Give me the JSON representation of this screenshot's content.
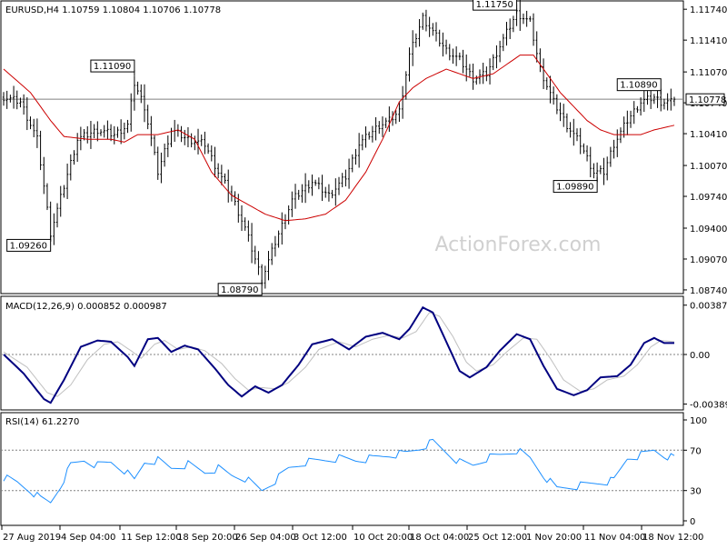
{
  "chart_data": [
    {
      "type": "candlestick",
      "symbol": "EURUSD",
      "timeframe": "H4",
      "header": "EURUSD,H4  1.10759 1.10804 1.10706 1.10778",
      "ohlc": {
        "open": 1.10759,
        "high": 1.10804,
        "low": 1.10706,
        "close": 1.10778
      },
      "y_ticks": [
        "1.11740",
        "1.11410",
        "1.11070",
        "1.10740",
        "1.10410",
        "1.10070",
        "1.09740",
        "1.09400",
        "1.09070",
        "1.08740"
      ],
      "ylim": [
        1.0872,
        1.118
      ],
      "last_price": "1.10778",
      "watermark": "ActionForex.com",
      "x_labels": [
        "27 Aug 2019",
        "4 Sep 04:00",
        "11 Sep 12:00",
        "18 Sep 20:00",
        "26 Sep 04:00",
        "3 Oct 12:00",
        "10 Oct 20:00",
        "18 Oct 04:00",
        "25 Oct 12:00",
        "1 Nov 20:00",
        "11 Nov 04:00",
        "18 Nov 12:00"
      ],
      "annotations": [
        {
          "text": "1.09260",
          "bar": 14
        },
        {
          "text": "1.11090",
          "bar": 39
        },
        {
          "text": "1.08790",
          "bar": 77
        },
        {
          "text": "1.11750",
          "bar": 153
        },
        {
          "text": "1.09890",
          "bar": 177
        },
        {
          "text": "1.10890",
          "bar": 196
        }
      ],
      "close_path": [
        [
          0,
          1.108
        ],
        [
          5,
          1.1075
        ],
        [
          10,
          1.1035
        ],
        [
          14,
          1.0935
        ],
        [
          18,
          1.0985
        ],
        [
          22,
          1.1035
        ],
        [
          28,
          1.1045
        ],
        [
          33,
          1.104
        ],
        [
          37,
          1.105
        ],
        [
          39,
          1.1095
        ],
        [
          42,
          1.107
        ],
        [
          46,
          1.1
        ],
        [
          50,
          1.1045
        ],
        [
          55,
          1.1035
        ],
        [
          60,
          1.103
        ],
        [
          64,
          1.1
        ],
        [
          68,
          1.0975
        ],
        [
          72,
          1.094
        ],
        [
          77,
          1.0885
        ],
        [
          81,
          1.0925
        ],
        [
          86,
          1.097
        ],
        [
          92,
          1.099
        ],
        [
          97,
          1.0975
        ],
        [
          102,
          1.0995
        ],
        [
          106,
          1.103
        ],
        [
          112,
          1.105
        ],
        [
          115,
          1.1055
        ],
        [
          118,
          1.1065
        ],
        [
          121,
          1.1125
        ],
        [
          125,
          1.1165
        ],
        [
          128,
          1.115
        ],
        [
          132,
          1.113
        ],
        [
          136,
          1.112
        ],
        [
          140,
          1.11
        ],
        [
          144,
          1.1105
        ],
        [
          148,
          1.1135
        ],
        [
          153,
          1.117
        ],
        [
          157,
          1.116
        ],
        [
          160,
          1.111
        ],
        [
          164,
          1.1075
        ],
        [
          168,
          1.105
        ],
        [
          172,
          1.103
        ],
        [
          176,
          1.1
        ],
        [
          179,
          1.1
        ],
        [
          182,
          1.103
        ],
        [
          186,
          1.1055
        ],
        [
          190,
          1.1075
        ],
        [
          194,
          1.108
        ],
        [
          196,
          1.1075
        ],
        [
          200,
          1.1075
        ]
      ],
      "ma_path": [
        [
          0,
          1.111
        ],
        [
          8,
          1.1085
        ],
        [
          14,
          1.1055
        ],
        [
          18,
          1.1038
        ],
        [
          25,
          1.1035
        ],
        [
          32,
          1.1035
        ],
        [
          36,
          1.1032
        ],
        [
          40,
          1.104
        ],
        [
          46,
          1.104
        ],
        [
          52,
          1.1045
        ],
        [
          57,
          1.1035
        ],
        [
          62,
          1.1
        ],
        [
          68,
          1.0975
        ],
        [
          73,
          1.0965
        ],
        [
          78,
          1.0955
        ],
        [
          84,
          1.0948
        ],
        [
          90,
          1.095
        ],
        [
          96,
          1.0955
        ],
        [
          102,
          1.097
        ],
        [
          108,
          1.1
        ],
        [
          113,
          1.1035
        ],
        [
          118,
          1.1075
        ],
        [
          122,
          1.109
        ],
        [
          126,
          1.11
        ],
        [
          132,
          1.111
        ],
        [
          136,
          1.1105
        ],
        [
          140,
          1.11
        ],
        [
          146,
          1.1105
        ],
        [
          150,
          1.1115
        ],
        [
          154,
          1.1125
        ],
        [
          158,
          1.1125
        ],
        [
          162,
          1.1105
        ],
        [
          166,
          1.1085
        ],
        [
          170,
          1.107
        ],
        [
          174,
          1.1055
        ],
        [
          178,
          1.1045
        ],
        [
          182,
          1.104
        ],
        [
          186,
          1.104
        ],
        [
          190,
          1.104
        ],
        [
          194,
          1.1045
        ],
        [
          200,
          1.105
        ]
      ],
      "range_pattern": [
        0.0011,
        0.0018,
        0.0007,
        0.0023,
        0.0013,
        0.0009,
        0.0016,
        0.0021,
        0.0008,
        0.0014,
        0.0026,
        0.0011,
        0.0017,
        0.0006,
        0.0012,
        0.0019
      ],
      "n_bars": 201,
      "colors": {
        "candle": "#000000",
        "ma": "#cc0000",
        "hline": "#808080"
      }
    },
    {
      "type": "line",
      "title": "MACD(12,26,9) 0.000852 0.000987",
      "y_ticks": [
        "0.003876",
        "0.00",
        "-0.003899"
      ],
      "ylim": [
        -0.004,
        0.004
      ],
      "macd_path": [
        [
          0,
          0.0
        ],
        [
          6,
          -0.0015
        ],
        [
          12,
          -0.0035
        ],
        [
          14,
          -0.0038
        ],
        [
          18,
          -0.002
        ],
        [
          23,
          0.0006
        ],
        [
          28,
          0.0011
        ],
        [
          32,
          0.001
        ],
        [
          37,
          -0.0002
        ],
        [
          39,
          -0.0009
        ],
        [
          43,
          0.0012
        ],
        [
          46,
          0.0013
        ],
        [
          50,
          0.0002
        ],
        [
          54,
          0.0007
        ],
        [
          58,
          0.0004
        ],
        [
          63,
          -0.0011
        ],
        [
          67,
          -0.0024
        ],
        [
          71,
          -0.0033
        ],
        [
          75,
          -0.0025
        ],
        [
          79,
          -0.003
        ],
        [
          83,
          -0.0024
        ],
        [
          88,
          -0.0008
        ],
        [
          92,
          0.0008
        ],
        [
          98,
          0.0012
        ],
        [
          103,
          0.0004
        ],
        [
          108,
          0.0014
        ],
        [
          113,
          0.0017
        ],
        [
          118,
          0.0012
        ],
        [
          121,
          0.002
        ],
        [
          125,
          0.0037
        ],
        [
          128,
          0.0033
        ],
        [
          132,
          0.001
        ],
        [
          136,
          -0.0013
        ],
        [
          139,
          -0.0018
        ],
        [
          144,
          -0.001
        ],
        [
          148,
          0.0003
        ],
        [
          153,
          0.0016
        ],
        [
          157,
          0.0012
        ],
        [
          161,
          -0.0009
        ],
        [
          165,
          -0.0027
        ],
        [
          170,
          -0.0032
        ],
        [
          174,
          -0.0028
        ],
        [
          178,
          -0.0018
        ],
        [
          183,
          -0.0017
        ],
        [
          187,
          -0.0008
        ],
        [
          191,
          0.0009
        ],
        [
          194,
          0.0013
        ],
        [
          197,
          0.0009
        ],
        [
          200,
          0.0009
        ]
      ],
      "signal_path": [
        [
          0,
          0.0002
        ],
        [
          7,
          -0.001
        ],
        [
          13,
          -0.003
        ],
        [
          16,
          -0.0033
        ],
        [
          20,
          -0.0024
        ],
        [
          25,
          -0.0004
        ],
        [
          30,
          0.0008
        ],
        [
          34,
          0.001
        ],
        [
          38,
          0.0003
        ],
        [
          41,
          -0.0003
        ],
        [
          45,
          0.0008
        ],
        [
          48,
          0.0011
        ],
        [
          52,
          0.0004
        ],
        [
          56,
          0.0006
        ],
        [
          60,
          0.0003
        ],
        [
          65,
          -0.0007
        ],
        [
          69,
          -0.0019
        ],
        [
          73,
          -0.0028
        ],
        [
          77,
          -0.0026
        ],
        [
          81,
          -0.0027
        ],
        [
          85,
          -0.0022
        ],
        [
          90,
          -0.001
        ],
        [
          94,
          0.0004
        ],
        [
          100,
          0.001
        ],
        [
          105,
          0.0006
        ],
        [
          110,
          0.0012
        ],
        [
          115,
          0.0015
        ],
        [
          119,
          0.0013
        ],
        [
          123,
          0.0018
        ],
        [
          127,
          0.0033
        ],
        [
          130,
          0.003
        ],
        [
          134,
          0.0014
        ],
        [
          138,
          -0.0006
        ],
        [
          141,
          -0.0013
        ],
        [
          146,
          -0.0008
        ],
        [
          150,
          0.0002
        ],
        [
          155,
          0.0013
        ],
        [
          159,
          0.0012
        ],
        [
          163,
          -0.0003
        ],
        [
          167,
          -0.002
        ],
        [
          172,
          -0.0029
        ],
        [
          176,
          -0.0027
        ],
        [
          180,
          -0.002
        ],
        [
          185,
          -0.0017
        ],
        [
          189,
          -0.0008
        ],
        [
          193,
          0.0006
        ],
        [
          196,
          0.0011
        ],
        [
          200,
          0.001
        ]
      ],
      "colors": {
        "macd": "#000080",
        "signal": "#c0c0c0"
      }
    },
    {
      "type": "line",
      "title": "RSI(14) 61.2270",
      "y_ticks": [
        "100",
        "70",
        "30",
        "0"
      ],
      "ylim": [
        0,
        100
      ],
      "levels": [
        70,
        30
      ],
      "rsi_path": [
        [
          0,
          43
        ],
        [
          4,
          38
        ],
        [
          8,
          30
        ],
        [
          11,
          22
        ],
        [
          14,
          18
        ],
        [
          17,
          35
        ],
        [
          20,
          55
        ],
        [
          24,
          60
        ],
        [
          28,
          55
        ],
        [
          32,
          58
        ],
        [
          36,
          50
        ],
        [
          39,
          40
        ],
        [
          42,
          58
        ],
        [
          46,
          60
        ],
        [
          50,
          52
        ],
        [
          55,
          56
        ],
        [
          60,
          48
        ],
        [
          64,
          52
        ],
        [
          68,
          45
        ],
        [
          72,
          42
        ],
        [
          77,
          30
        ],
        [
          81,
          40
        ],
        [
          85,
          52
        ],
        [
          90,
          58
        ],
        [
          95,
          60
        ],
        [
          100,
          62
        ],
        [
          105,
          60
        ],
        [
          110,
          62
        ],
        [
          115,
          65
        ],
        [
          120,
          67
        ],
        [
          124,
          72
        ],
        [
          128,
          78
        ],
        [
          132,
          68
        ],
        [
          136,
          58
        ],
        [
          140,
          55
        ],
        [
          144,
          62
        ],
        [
          148,
          65
        ],
        [
          153,
          70
        ],
        [
          157,
          62
        ],
        [
          161,
          45
        ],
        [
          165,
          32
        ],
        [
          170,
          34
        ],
        [
          174,
          36
        ],
        [
          178,
          38
        ],
        [
          182,
          40
        ],
        [
          186,
          62
        ],
        [
          190,
          65
        ],
        [
          194,
          70
        ],
        [
          197,
          65
        ],
        [
          200,
          62
        ]
      ],
      "colors": {
        "rsi": "#1e90ff",
        "level": "#808080"
      }
    }
  ]
}
